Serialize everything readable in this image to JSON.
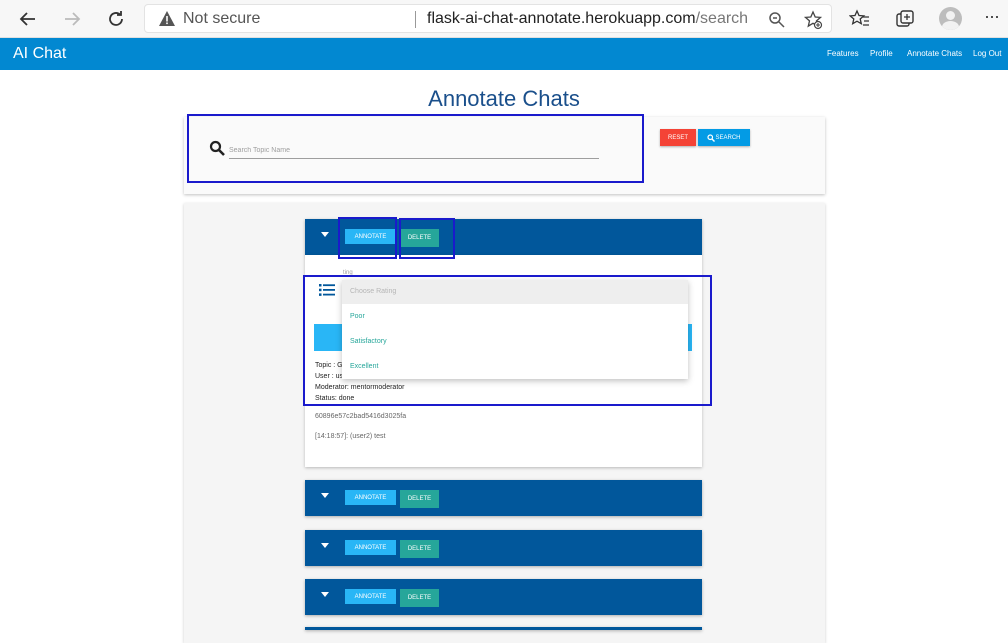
{
  "browser": {
    "not_secure_label": "Not secure",
    "url_host": "flask-ai-chat-annotate.herokuapp.com",
    "url_path": "/search"
  },
  "navbar": {
    "brand": "AI Chat",
    "links": [
      "Features",
      "Profile",
      "Annotate Chats",
      "Log Out"
    ],
    "color": "#0288d1"
  },
  "page": {
    "title": "Annotate Chats"
  },
  "search": {
    "placeholder": "Search Topic Name",
    "value": "",
    "reset_label": "RESET",
    "search_label": "SEARCH"
  },
  "chats": [
    {
      "annotate_label": "ANNOTATE",
      "delete_label": "DELETE",
      "expanded": true,
      "rating_label": "ting",
      "rating_options": [
        "Choose Rating",
        "Poor",
        "Satisfactory",
        "Excellent"
      ],
      "topic": "Topic : G",
      "user": "User : us",
      "moderator": "Moderator: mentormoderator",
      "status": "Status: done",
      "id": "60896e57c2bad5416d3025fa",
      "message": "[14:18:57]: (user2) test"
    },
    {
      "annotate_label": "ANNOTATE",
      "delete_label": "DELETE"
    },
    {
      "annotate_label": "ANNOTATE",
      "delete_label": "DELETE"
    },
    {
      "annotate_label": "ANNOTATE",
      "delete_label": "DELETE"
    }
  ],
  "colors": {
    "header_item": "#01579b",
    "annotate": "#29b6f6",
    "delete": "#26a69a",
    "reset": "#f44336",
    "search": "#039be5",
    "highlight": "#1a1acc"
  }
}
